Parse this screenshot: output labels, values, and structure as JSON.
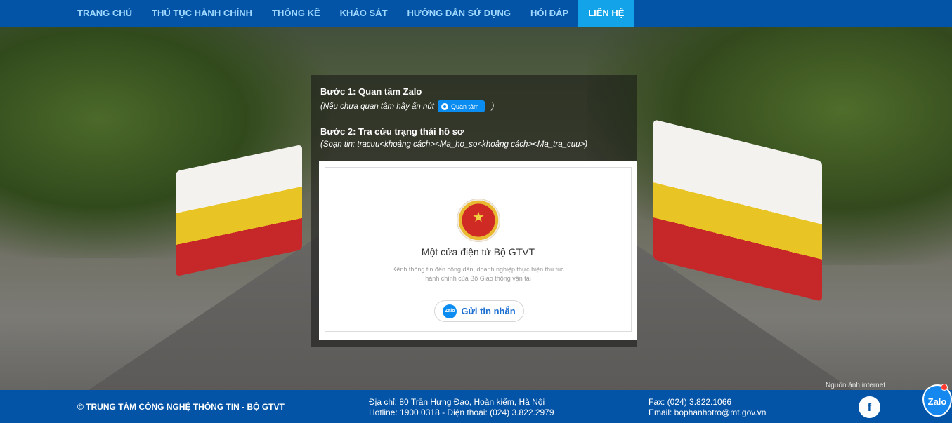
{
  "nav": {
    "items": [
      {
        "label": "TRANG CHỦ"
      },
      {
        "label": "THỦ TỤC HÀNH CHÍNH"
      },
      {
        "label": "THỐNG KÊ"
      },
      {
        "label": "KHẢO SÁT"
      },
      {
        "label": "HƯỚNG DẪN SỬ DỤNG"
      },
      {
        "label": "HỎI ĐÁP"
      },
      {
        "label": "LIÊN HỆ",
        "active": true
      }
    ]
  },
  "steps": {
    "step1_title": "Bước 1: Quan tâm Zalo",
    "step1_note_prefix": "(Nếu chưa quan tâm hãy ấn nút",
    "step1_button": "Quan tâm",
    "step1_note_suffix": ")",
    "step2_title": "Bước 2: Tra cứu trạng thái hồ sơ",
    "step2_note": "(Soạn tin: tracuu<khoảng cách><Ma_ho_so<khoảng cách><Ma_tra_cuu>)"
  },
  "widget": {
    "title": "Một cửa điện tử Bộ GTVT",
    "desc": "Kênh thông tin đến công dân, doanh nghiệp thực hiện thủ tục hành chính của Bộ Giao thông vận tải",
    "send_icon": "Zalo",
    "send_label": "Gửi tin nhắn"
  },
  "image_credit": "Nguồn ảnh internet",
  "footer": {
    "copyright": "© TRUNG TÂM CÔNG NGHỆ THÔNG TIN - BỘ GTVT",
    "address": "Địa chỉ: 80 Trần Hưng Đạo, Hoàn kiếm, Hà Nội",
    "hotline": "Hotline: 1900 0318 - Điện thoại: (024) 3.822.2979",
    "fax": "Fax: (024) 3.822.1066",
    "email": "Email: bophanhotro@mt.gov.vn",
    "facebook_icon": "f"
  },
  "zalo_float": {
    "label": "Zalo"
  },
  "colors": {
    "nav_bg": "#0354a6",
    "nav_active": "#13a3e8",
    "zalo_blue": "#0a8cf0"
  }
}
